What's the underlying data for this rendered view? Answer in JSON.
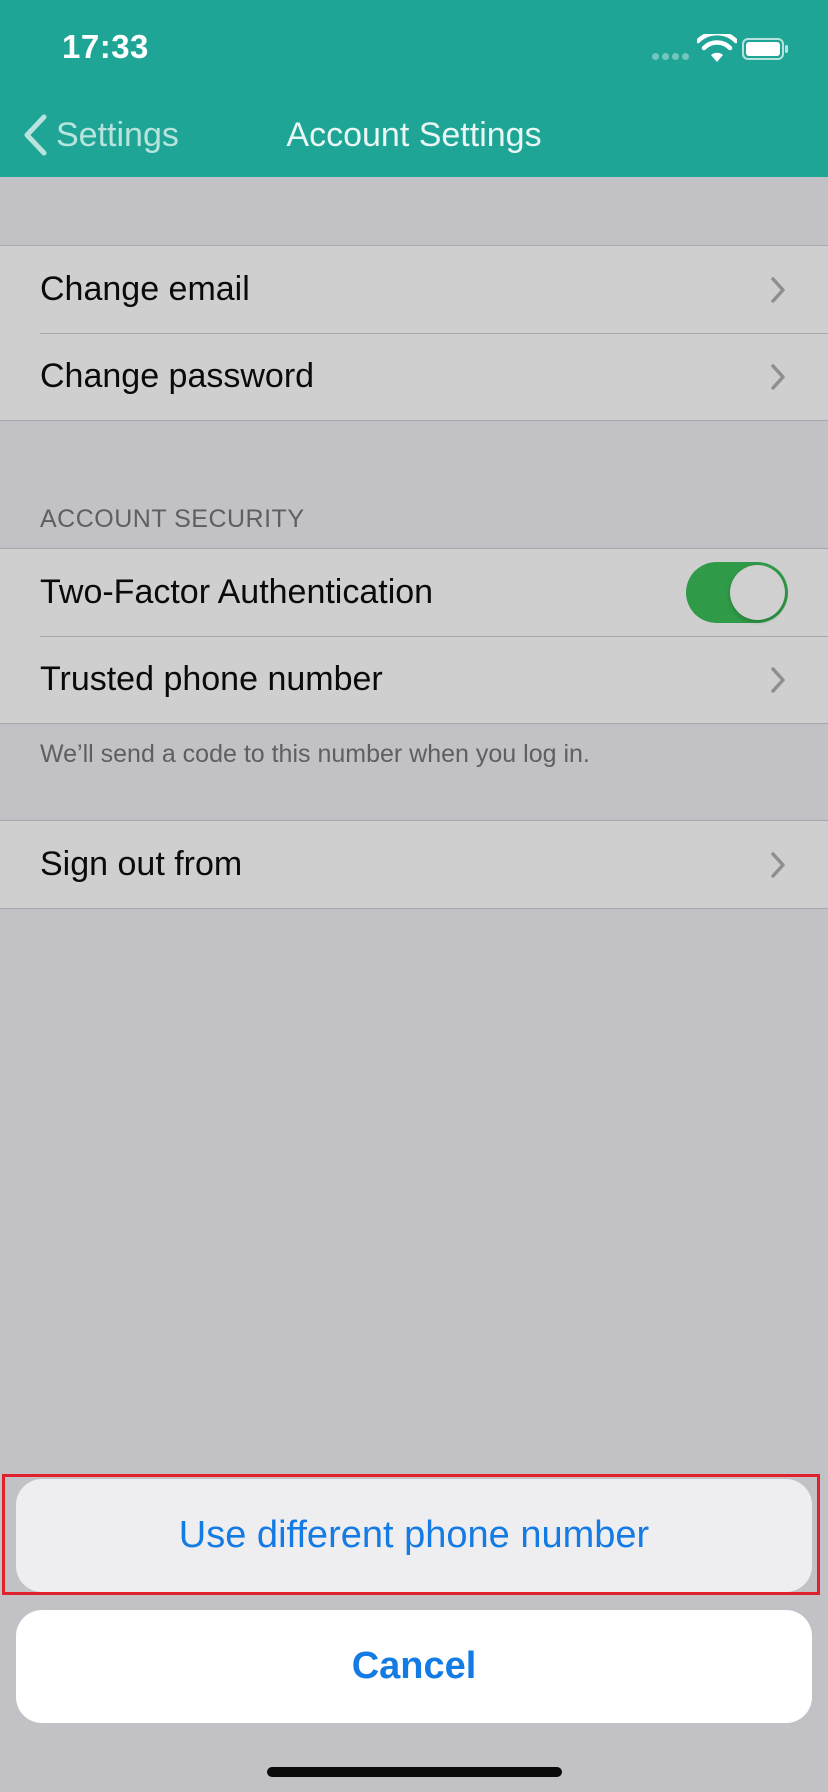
{
  "status_bar": {
    "time": "17:33",
    "signal_icon": "cellular-signal-icon",
    "wifi_icon": "wifi-icon",
    "battery_icon": "battery-full-icon"
  },
  "nav": {
    "back_label": "Settings",
    "title": "Account Settings"
  },
  "account_group": {
    "items": [
      {
        "label": "Change email"
      },
      {
        "label": "Change password"
      }
    ]
  },
  "security": {
    "header": "ACCOUNT SECURITY",
    "two_factor_label": "Two-Factor Authentication",
    "two_factor_enabled": true,
    "trusted_phone_label": "Trusted phone number",
    "footer": "We’ll send a code to this number when you log in."
  },
  "sign_out": {
    "label": "Sign out from"
  },
  "action_sheet": {
    "action_label": "Use different phone number",
    "cancel_label": "Cancel"
  },
  "colors": {
    "nav_background": "#1fa596",
    "dimmed_background": "#c2c1c6",
    "toggle_on": "#2f9a47",
    "action_text": "#157be4",
    "highlight_border": "#e0202a"
  }
}
